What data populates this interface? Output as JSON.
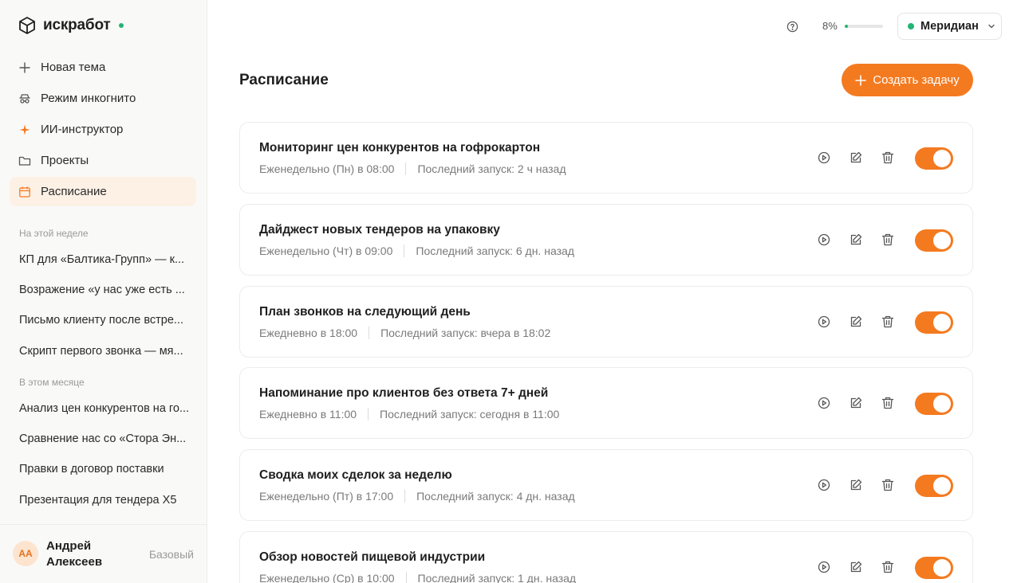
{
  "brand": {
    "name": "искработ"
  },
  "nav": [
    {
      "label": "Новая тема",
      "icon": "plus-icon"
    },
    {
      "label": "Режим инкогнито",
      "icon": "incognito-icon"
    },
    {
      "label": "ИИ-инструктор",
      "icon": "sparkle-icon"
    },
    {
      "label": "Проекты",
      "icon": "folder-icon"
    },
    {
      "label": "Расписание",
      "icon": "calendar-icon",
      "active": true
    }
  ],
  "history": {
    "week_label": "На этой неделе",
    "week": [
      "КП для «Балтика-Групп» — к...",
      "Возражение «у нас уже есть ...",
      "Письмо клиенту после встре...",
      "Скрипт первого звонка — мя..."
    ],
    "month_label": "В этом месяце",
    "month": [
      "Анализ цен конкурентов на го...",
      "Сравнение нас со «Стора Эн...",
      "Правки в договор поставки",
      "Презентация для тендера Х5"
    ]
  },
  "user": {
    "initials": "АА",
    "name": "Андрей Алексеев",
    "plan": "Базовый"
  },
  "topbar": {
    "usage_percent": "8%",
    "usage_fraction": 0.08,
    "model": "Меридиан"
  },
  "main": {
    "title": "Расписание",
    "create_label": "Создать задачу",
    "tasks": [
      {
        "title": "Мониторинг цен конкурентов на гофрокартон",
        "schedule": "Еженедельно (Пн) в 08:00",
        "last_run": "Последний запуск: 2 ч назад",
        "enabled": true
      },
      {
        "title": "Дайджест новых тендеров на упаковку",
        "schedule": "Еженедельно (Чт) в 09:00",
        "last_run": "Последний запуск: 6 дн. назад",
        "enabled": true
      },
      {
        "title": "План звонков на следующий день",
        "schedule": "Ежедневно в 18:00",
        "last_run": "Последний запуск: вчера в 18:02",
        "enabled": true
      },
      {
        "title": "Напоминание про клиентов без ответа 7+ дней",
        "schedule": "Ежедневно в 11:00",
        "last_run": "Последний запуск: сегодня в 11:00",
        "enabled": true
      },
      {
        "title": "Сводка моих сделок за неделю",
        "schedule": "Еженедельно (Пт) в 17:00",
        "last_run": "Последний запуск: 4 дн. назад",
        "enabled": true
      },
      {
        "title": "Обзор новостей пищевой индустрии",
        "schedule": "Еженедельно (Ср) в 10:00",
        "last_run": "Последний запуск: 1 дн. назад",
        "enabled": true
      }
    ]
  },
  "colors": {
    "accent": "#f47a20",
    "status": "#22b573",
    "active_bg": "#fdf1e6"
  }
}
